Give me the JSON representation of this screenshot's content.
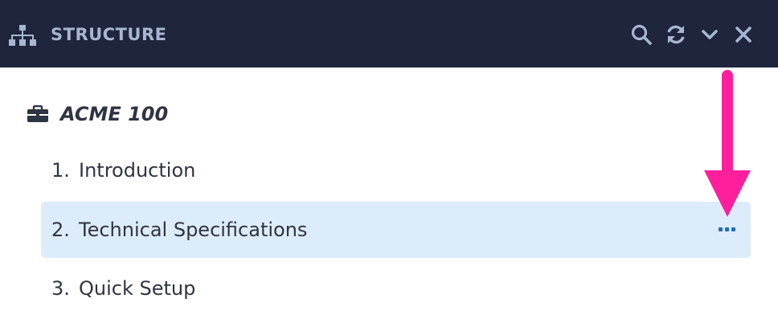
{
  "header": {
    "title": "STRUCTURE",
    "icons": [
      "sitemap-icon",
      "search-icon",
      "refresh-icon",
      "chevron-down-icon",
      "close-icon"
    ],
    "background": "#1e253c",
    "title_color": "#a9b6cf"
  },
  "tree": {
    "root": {
      "label": "ACME 100",
      "icon": "briefcase-icon"
    },
    "items": [
      {
        "number": "1.",
        "label": "Introduction"
      },
      {
        "number": "2.",
        "label": "Technical Specifications",
        "selected": true
      },
      {
        "number": "3.",
        "label": "Quick Setup"
      }
    ],
    "selected_color": "#ddecfb"
  },
  "annotation": {
    "arrow_color": "#ff1f9c",
    "icon": "arrow-down-icon"
  }
}
